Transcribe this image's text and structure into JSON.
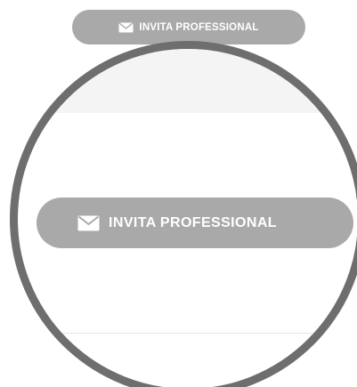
{
  "buttons": {
    "invite_label": "INVITA PROFESSIONAL",
    "icon": "envelope-icon"
  },
  "colors": {
    "button_bg": "#a9a9a9",
    "button_text": "#ffffff",
    "lens_border": "#6e6e6e",
    "band_bg": "#f4f4f4"
  }
}
